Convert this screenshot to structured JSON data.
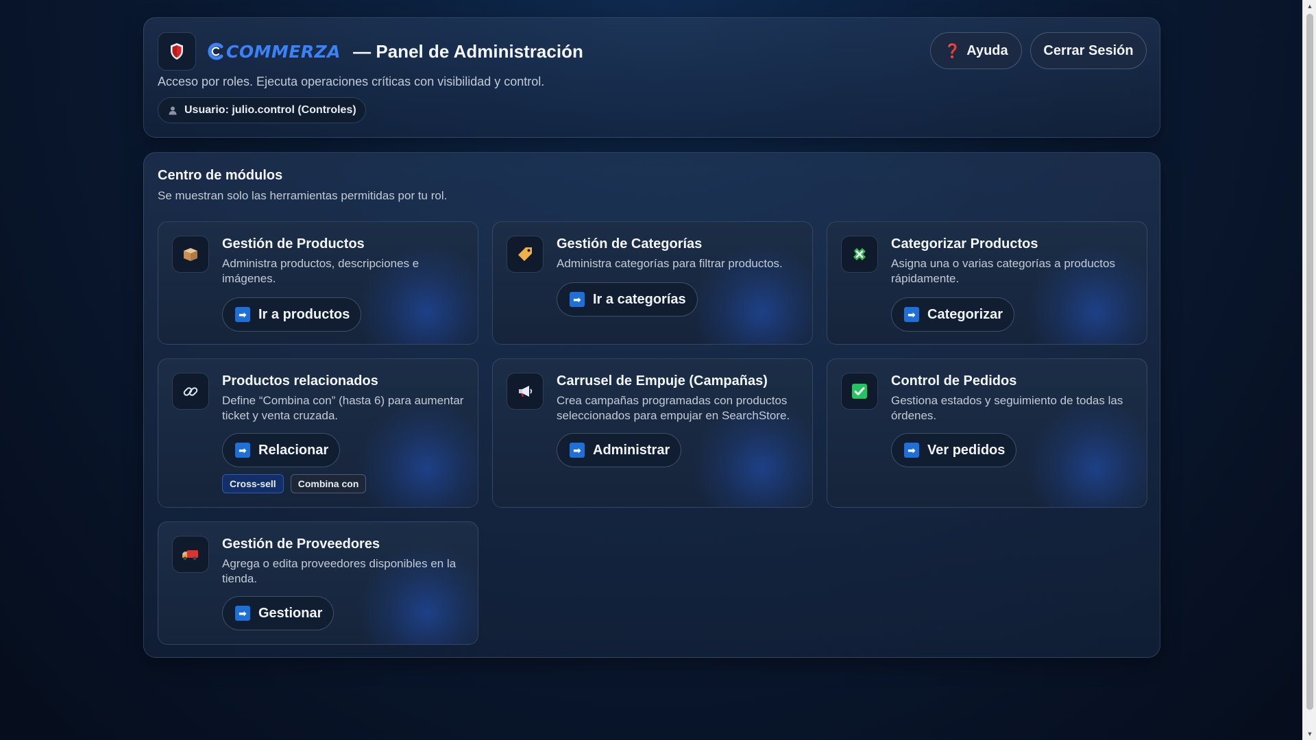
{
  "header": {
    "brand": "COMMERZA",
    "title": "— Panel de Administración",
    "subtitle": "Acceso por roles. Ejecuta operaciones críticas con visibilidad y control.",
    "user_label": "Usuario: julio.control (Controles)",
    "help_label": "Ayuda",
    "logout_label": "Cerrar Sesión"
  },
  "modules": {
    "title": "Centro de módulos",
    "subtitle": "Se muestran solo las herramientas permitidas por tu rol.",
    "cards": [
      {
        "icon": "box-icon",
        "title": "Gestión de Productos",
        "desc": "Administra productos, descripciones e imágenes.",
        "button": "Ir a productos"
      },
      {
        "icon": "tag-icon",
        "title": "Gestión de Categorías",
        "desc": "Administra categorías para filtrar productos.",
        "button": "Ir a categorías"
      },
      {
        "icon": "puzzle-icon",
        "title": "Categorizar Productos",
        "desc": "Asigna una o varias categorías a productos rápidamente.",
        "button": "Categorizar"
      },
      {
        "icon": "link-icon",
        "title": "Productos relacionados",
        "desc": "Define “Combina con” (hasta 6) para aumentar ticket y venta cruzada.",
        "button": "Relacionar",
        "tags": [
          "Cross-sell",
          "Combina con"
        ]
      },
      {
        "icon": "megaphone-icon",
        "title": "Carrusel de Empuje (Campañas)",
        "desc": "Crea campañas programadas con productos seleccionados para empujar en SearchStore.",
        "button": "Administrar"
      },
      {
        "icon": "check-icon",
        "title": "Control de Pedidos",
        "desc": "Gestiona estados y seguimiento de todas las órdenes.",
        "button": "Ver pedidos"
      },
      {
        "icon": "truck-icon",
        "title": "Gestión de Proveedores",
        "desc": "Agrega o edita proveedores disponibles en la tienda.",
        "button": "Gestionar"
      }
    ]
  },
  "colors": {
    "accent": "#3b82f6",
    "button_arrow": "#1e6fd6",
    "check": "#22c55e"
  }
}
